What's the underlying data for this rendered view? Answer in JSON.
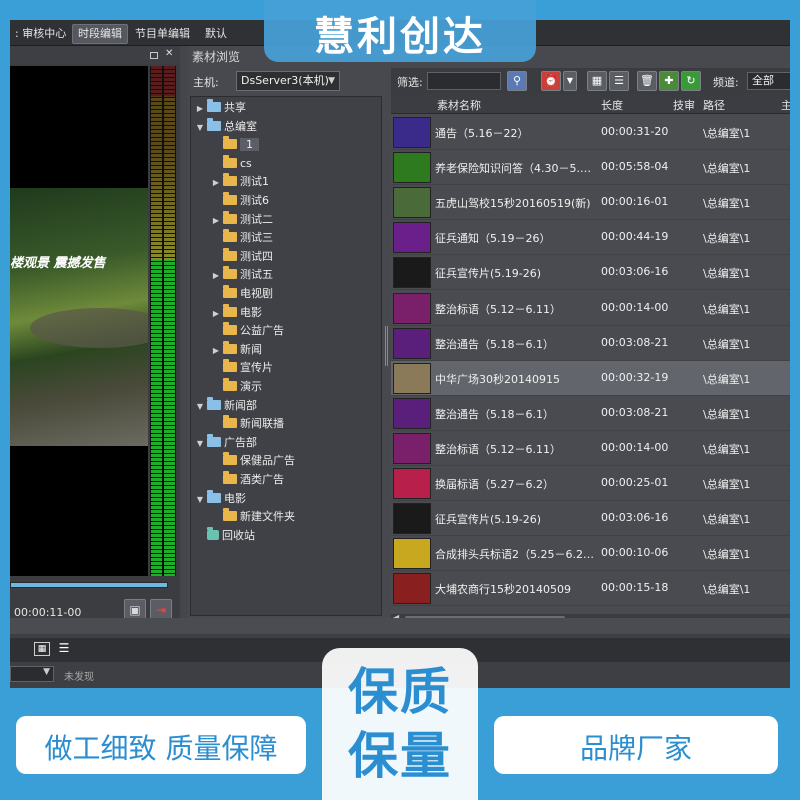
{
  "menu": {
    "items": [
      {
        "label": ": 审核中心",
        "active": false
      },
      {
        "label": "时段编辑",
        "active": true
      },
      {
        "label": "节目单编辑",
        "active": false
      },
      {
        "label": "默认",
        "active": false
      }
    ]
  },
  "preview": {
    "caption": "楼观景 震撼发售",
    "timecode": "00:00:11-00",
    "save_icon": "save-icon",
    "export_icon": "export-icon"
  },
  "browser": {
    "title": "素材浏览",
    "host_label": "主机:",
    "host_value": "DsServer3(本机)",
    "filter_label": "筛选:",
    "channel_label": "频道:",
    "channel_value": "全部",
    "columns": {
      "name": "素材名称",
      "length": "长度",
      "review": "技审",
      "path": "路径",
      "extra": "主"
    },
    "tree": [
      {
        "label": "共享",
        "depth": 0,
        "expand": "▶",
        "icon": "special"
      },
      {
        "label": "总编室",
        "depth": 0,
        "expand": "▼",
        "icon": "special"
      },
      {
        "label": "1",
        "depth": 1,
        "expand": "",
        "icon": "folder",
        "selected": true
      },
      {
        "label": "cs",
        "depth": 1,
        "expand": "",
        "icon": "folder"
      },
      {
        "label": "测试1",
        "depth": 1,
        "expand": "▶",
        "icon": "folder"
      },
      {
        "label": "测试6",
        "depth": 1,
        "expand": "",
        "icon": "folder"
      },
      {
        "label": "测试二",
        "depth": 1,
        "expand": "▶",
        "icon": "folder"
      },
      {
        "label": "测试三",
        "depth": 1,
        "expand": "",
        "icon": "folder"
      },
      {
        "label": "测试四",
        "depth": 1,
        "expand": "",
        "icon": "folder"
      },
      {
        "label": "测试五",
        "depth": 1,
        "expand": "▶",
        "icon": "folder"
      },
      {
        "label": "电视剧",
        "depth": 1,
        "expand": "",
        "icon": "folder"
      },
      {
        "label": "电影",
        "depth": 1,
        "expand": "▶",
        "icon": "folder"
      },
      {
        "label": "公益广告",
        "depth": 1,
        "expand": "",
        "icon": "folder"
      },
      {
        "label": "新闻",
        "depth": 1,
        "expand": "▶",
        "icon": "folder"
      },
      {
        "label": "宣传片",
        "depth": 1,
        "expand": "",
        "icon": "folder"
      },
      {
        "label": "演示",
        "depth": 1,
        "expand": "",
        "icon": "folder"
      },
      {
        "label": "新闻部",
        "depth": 0,
        "expand": "▼",
        "icon": "special"
      },
      {
        "label": "新闻联播",
        "depth": 1,
        "expand": "",
        "icon": "folder"
      },
      {
        "label": "广告部",
        "depth": 0,
        "expand": "▼",
        "icon": "special"
      },
      {
        "label": "保健品广告",
        "depth": 1,
        "expand": "",
        "icon": "folder"
      },
      {
        "label": "酒类广告",
        "depth": 1,
        "expand": "",
        "icon": "folder"
      },
      {
        "label": "电影",
        "depth": 0,
        "expand": "▼",
        "icon": "special"
      },
      {
        "label": "新建文件夹",
        "depth": 1,
        "expand": "",
        "icon": "folder"
      },
      {
        "label": "回收站",
        "depth": 0,
        "expand": "",
        "icon": "trash"
      }
    ],
    "rows": [
      {
        "name": "通告（5.16－22）",
        "length": "00:00:31-20",
        "path": "\\总编室\\1",
        "thumb": "#3a2a8a",
        "selected": false
      },
      {
        "name": "养老保险知识问答（4.30－5.…",
        "length": "00:05:58-04",
        "path": "\\总编室\\1",
        "thumb": "#2d7a1f",
        "selected": false
      },
      {
        "name": "五虎山驾校15秒20160519(新)",
        "length": "00:00:16-01",
        "path": "\\总编室\\1",
        "thumb": "#4a6a3a",
        "selected": false
      },
      {
        "name": "征兵通知（5.19－26）",
        "length": "00:00:44-19",
        "path": "\\总编室\\1",
        "thumb": "#6a1f8a",
        "selected": false
      },
      {
        "name": "征兵宣传片(5.19-26)",
        "length": "00:03:06-16",
        "path": "\\总编室\\1",
        "thumb": "#1a1a1a",
        "selected": false
      },
      {
        "name": "整治标语（5.12－6.11）",
        "length": "00:00:14-00",
        "path": "\\总编室\\1",
        "thumb": "#7a1f6a",
        "selected": false
      },
      {
        "name": "整治通告（5.18－6.1）",
        "length": "00:03:08-21",
        "path": "\\总编室\\1",
        "thumb": "#5a1f7a",
        "selected": false
      },
      {
        "name": "中华广场30秒20140915",
        "length": "00:00:32-19",
        "path": "\\总编室\\1",
        "thumb": "#8a7a5a",
        "selected": true
      },
      {
        "name": "整治通告（5.18－6.1）",
        "length": "00:03:08-21",
        "path": "\\总编室\\1",
        "thumb": "#5a1f7a",
        "selected": false
      },
      {
        "name": "整治标语（5.12－6.11）",
        "length": "00:00:14-00",
        "path": "\\总编室\\1",
        "thumb": "#7a1f6a",
        "selected": false
      },
      {
        "name": "换届标语（5.27－6.2）",
        "length": "00:00:25-01",
        "path": "\\总编室\\1",
        "thumb": "#b81f4a",
        "selected": false
      },
      {
        "name": "征兵宣传片(5.19-26)",
        "length": "00:03:06-16",
        "path": "\\总编室\\1",
        "thumb": "#1a1a1a",
        "selected": false
      },
      {
        "name": "合成排头兵标语2（5.25－6.2…",
        "length": "00:00:10-06",
        "path": "\\总编室\\1",
        "thumb": "#c8a81f",
        "selected": false
      },
      {
        "name": "大埔农商行15秒20140509",
        "length": "00:00:15-18",
        "path": "\\总编室\\1",
        "thumb": "#8a1f1f",
        "selected": false
      }
    ]
  },
  "lower": {
    "status": "未发现"
  },
  "promo": {
    "brand": "慧利创达",
    "big_line1": "保质",
    "big_line2": "保量",
    "left_pill": "做工细致  质量保障",
    "right_pill": "品牌厂家"
  },
  "colors": {
    "background": "#3a9fd6",
    "promo_text": "#2b8ed1",
    "app_bg": "#44464b"
  }
}
